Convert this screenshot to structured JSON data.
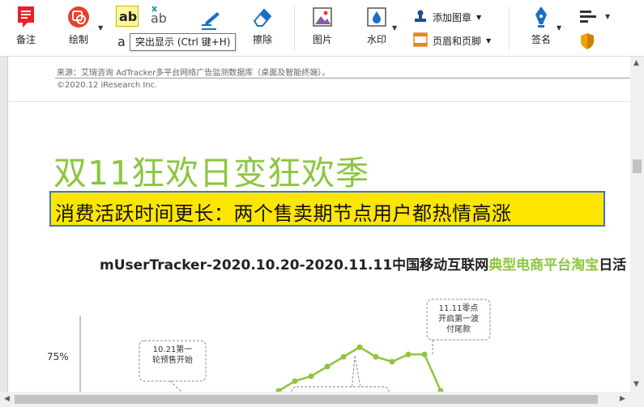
{
  "toolbar": {
    "note_label": "备注",
    "draw_label": "绘制",
    "erase_label": "擦除",
    "image_label": "图片",
    "watermark_label": "水印",
    "add_stamp_label": "添加图章",
    "header_footer_label": "页眉和页脚",
    "sign_label": "签名",
    "highlight_tooltip": "突出显示 (Ctrl 键+H)"
  },
  "document": {
    "source_line": "来源：艾瑞咨询 AdTracker多平台网络广告监测数据库（桌面及智能终端）。",
    "copyright": "©2020.12 iResearch Inc.",
    "title": "双11狂欢日变狂欢季",
    "subtitle": "消费活跃时间更长：两个售卖期节点用户都热情高涨",
    "chart_title_part1": "mUserTracker-2020.10.20-2020.11.11中国移动互联网",
    "chart_title_highlight": "典型电商平台淘宝",
    "chart_title_part2": "日活"
  },
  "chart_data": {
    "type": "line",
    "y_tick_labels": [
      "75%"
    ],
    "annotations": [
      {
        "text_lines": [
          "10.21第一",
          "轮预售开始"
        ]
      },
      {
        "text_lines": [
          "11.11零点",
          "开启第一波",
          "付尾款"
        ]
      }
    ],
    "series": [
      {
        "values": [
          0.68,
          0.7,
          0.71,
          0.73,
          0.75,
          0.77,
          0.75,
          0.74,
          0.755,
          0.755,
          0.68
        ]
      }
    ],
    "colors": {
      "line": "#8cc63f"
    }
  },
  "colors": {
    "accent_green": "#8cc63f",
    "highlight_yellow": "#ffe600",
    "selection_blue": "#3b78c9"
  }
}
